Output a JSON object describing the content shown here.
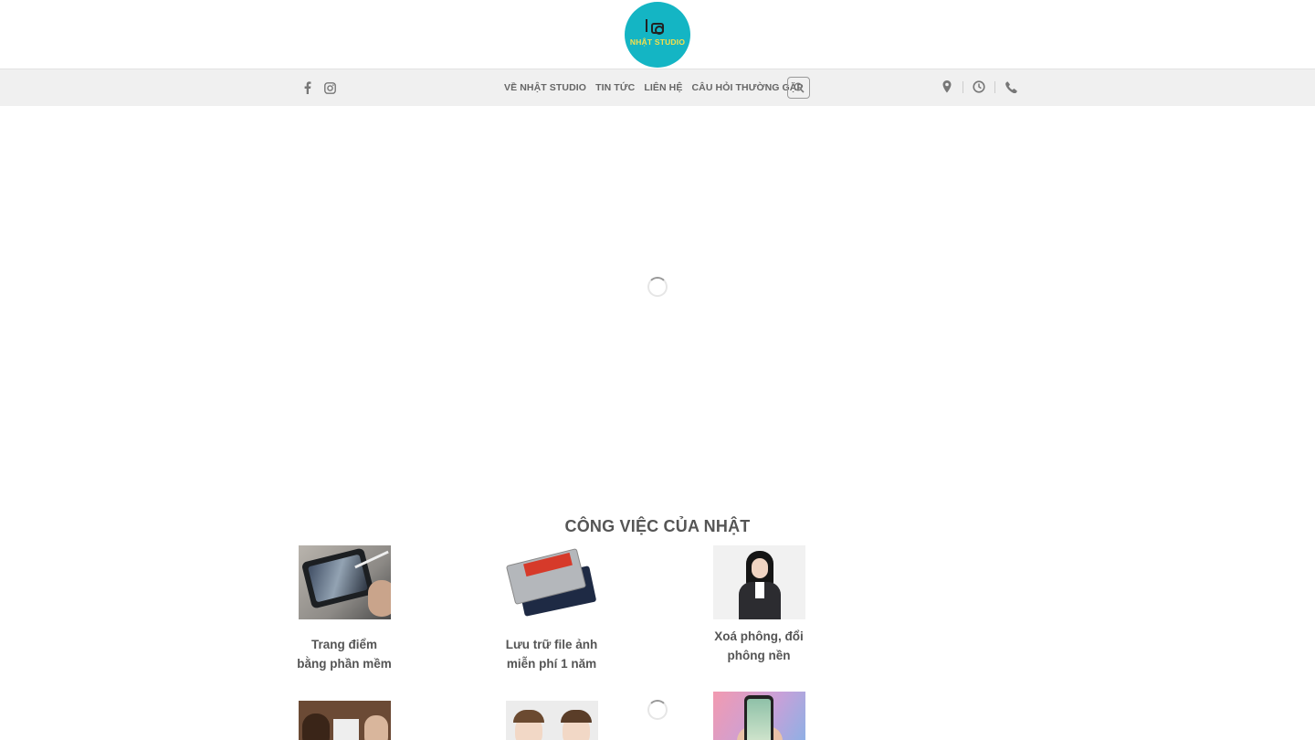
{
  "logo": {
    "text": "NHẬT STUDIO",
    "color": "#14b5c4"
  },
  "header": {
    "social": [
      {
        "icon": "facebook-icon"
      },
      {
        "icon": "instagram-icon"
      }
    ],
    "nav": [
      {
        "label": "VỀ NHẬT STUDIO"
      },
      {
        "label": "TIN TỨC"
      },
      {
        "label": "LIÊN HỆ"
      },
      {
        "label": "CÂU HỎI THƯỜNG GẶP"
      }
    ],
    "search_icon": "search-icon",
    "right_icons": [
      "location-icon",
      "clock-icon",
      "phone-icon"
    ]
  },
  "section": {
    "title": "CÔNG VIỆC CỦA NHẬT",
    "items": [
      {
        "label_line1": "Trang điểm",
        "label_line2": "bằng phần mềm"
      },
      {
        "label_line1": "Lưu trữ file ảnh",
        "label_line2": "miễn phí 1 năm"
      },
      {
        "label_line1": "Xoá phông, đổi",
        "label_line2": "phông nền"
      }
    ]
  }
}
